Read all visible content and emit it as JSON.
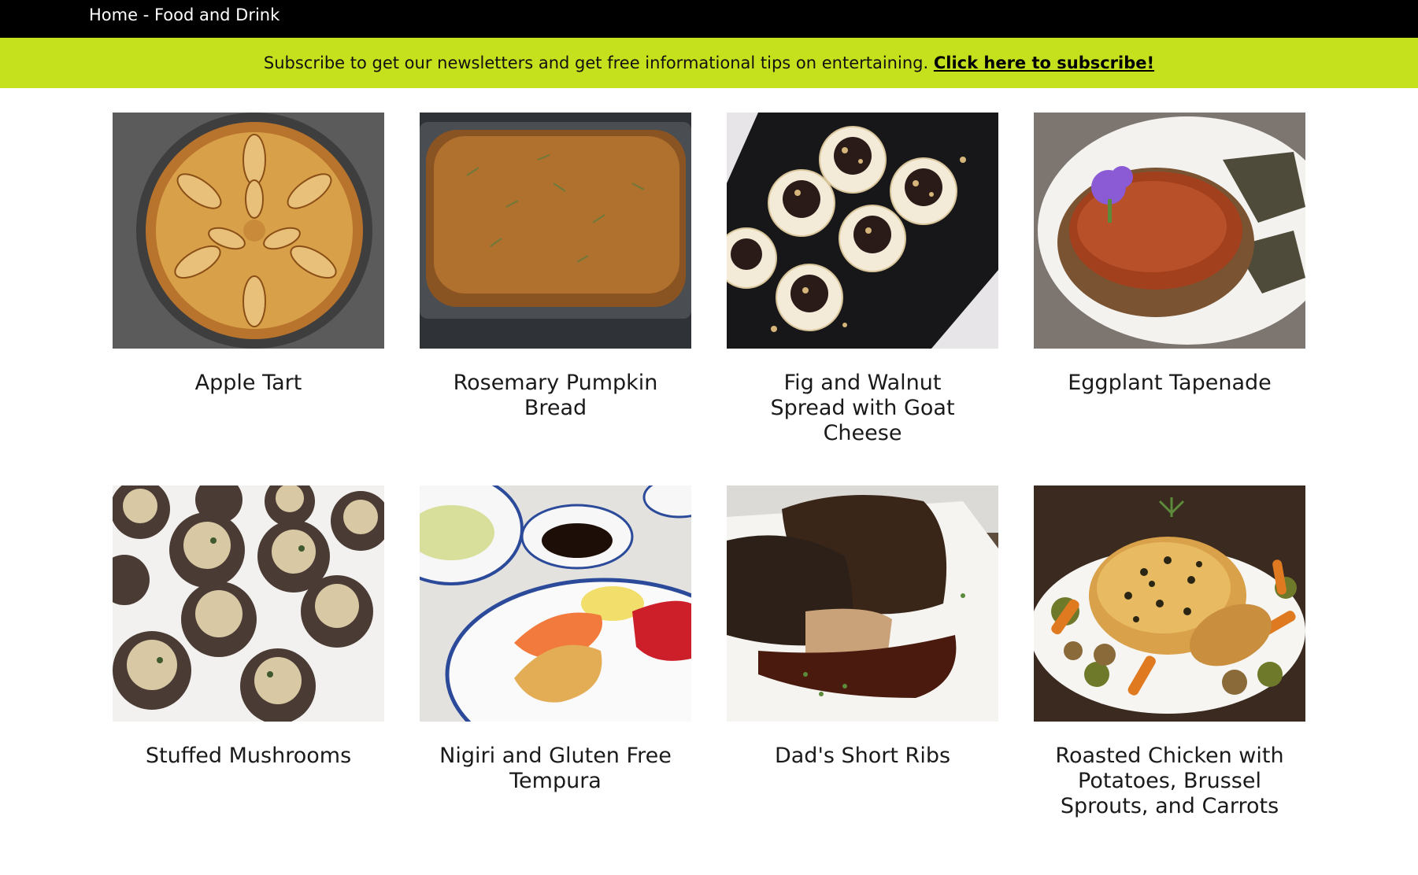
{
  "header": {
    "breadcrumb_home": "Home",
    "breadcrumb_sep": " - ",
    "breadcrumb_current": "Food and Drink"
  },
  "subscribe": {
    "text": "Subscribe to get our newsletters and get free informational tips on entertaining.",
    "link": "Click here to subscribe!"
  },
  "colors": {
    "topbar": "#000000",
    "subbar_accent": "#c5e01d"
  },
  "recipes": [
    {
      "title": "Apple Tart",
      "image_icon": "apple-tart-photo"
    },
    {
      "title": "Rosemary Pumpkin Bread",
      "image_icon": "pumpkin-bread-photo"
    },
    {
      "title": "Fig and Walnut Spread with Goat Cheese",
      "image_icon": "fig-walnut-crackers-photo"
    },
    {
      "title": "Eggplant Tapenade",
      "image_icon": "eggplant-tapenade-photo"
    },
    {
      "title": "Stuffed Mushrooms",
      "image_icon": "stuffed-mushrooms-photo"
    },
    {
      "title": "Nigiri and Gluten Free Tempura",
      "image_icon": "nigiri-tempura-photo"
    },
    {
      "title": "Dad's Short Ribs",
      "image_icon": "short-ribs-photo"
    },
    {
      "title": "Roasted Chicken with Potatoes, Brussel Sprouts, and Carrots",
      "image_icon": "roasted-chicken-photo"
    }
  ]
}
